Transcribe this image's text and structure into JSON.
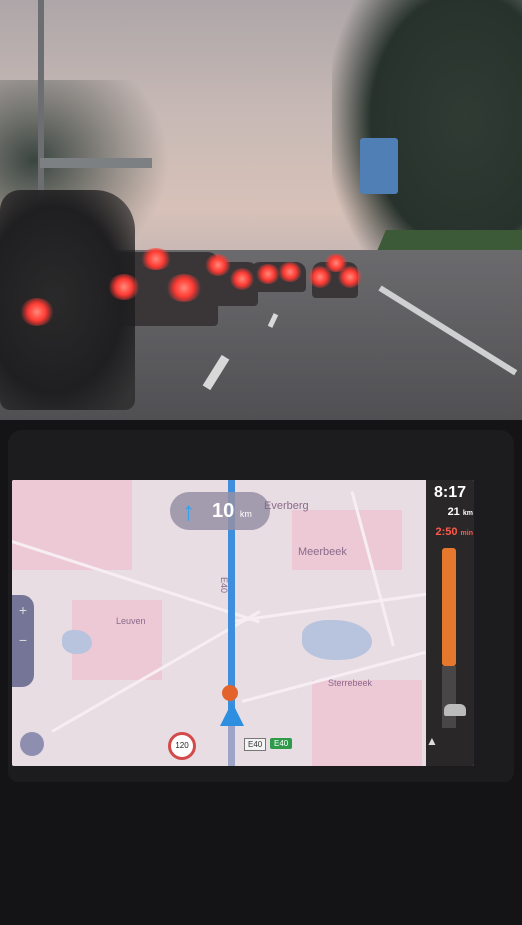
{
  "photo": {
    "scene": "road-view",
    "colors": {
      "sky": "#d4c0b9",
      "road": "#5a5a5d",
      "brake_light": "#ff3a33",
      "route_blue": "#3f8ede",
      "traffic_orange": "#e6782e"
    }
  },
  "navigation": {
    "next_instruction": {
      "direction_icon": "arrow-up-icon",
      "distance": "10",
      "unit": "km"
    },
    "map_labels": {
      "town_1": "Everberg",
      "town_2": "Meerbeek",
      "town_3": "Leuven",
      "town_4": "Sterrebeek",
      "road_label": "E40"
    },
    "speed_limit": "120",
    "road_shields": {
      "shield_1": "E40",
      "shield_2": "E40"
    },
    "side_panel": {
      "clock": "8:17",
      "remaining_distance": "21",
      "remaining_distance_unit": "km",
      "delay": "2:50",
      "delay_unit": "min"
    }
  }
}
